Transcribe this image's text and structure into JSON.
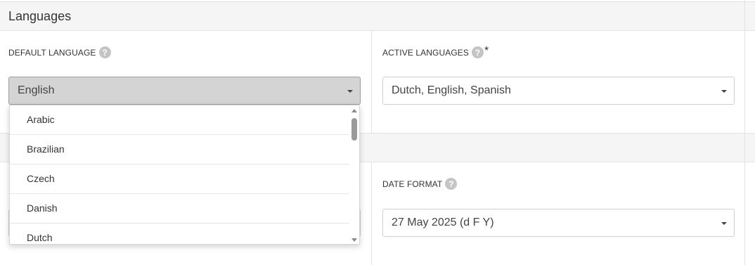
{
  "section": {
    "title": "Languages"
  },
  "default_language": {
    "label": "DEFAULT LANGUAGE",
    "help": "?",
    "value": "English",
    "options": [
      "Arabic",
      "Brazilian",
      "Czech",
      "Danish",
      "Dutch"
    ]
  },
  "active_languages": {
    "label": "ACTIVE LANGUAGES",
    "help": "?",
    "required": "*",
    "value": "Dutch, English, Spanish"
  },
  "date_format": {
    "label": "DATE FORMAT",
    "help": "?",
    "value": "27 May 2025 (d F Y)"
  }
}
